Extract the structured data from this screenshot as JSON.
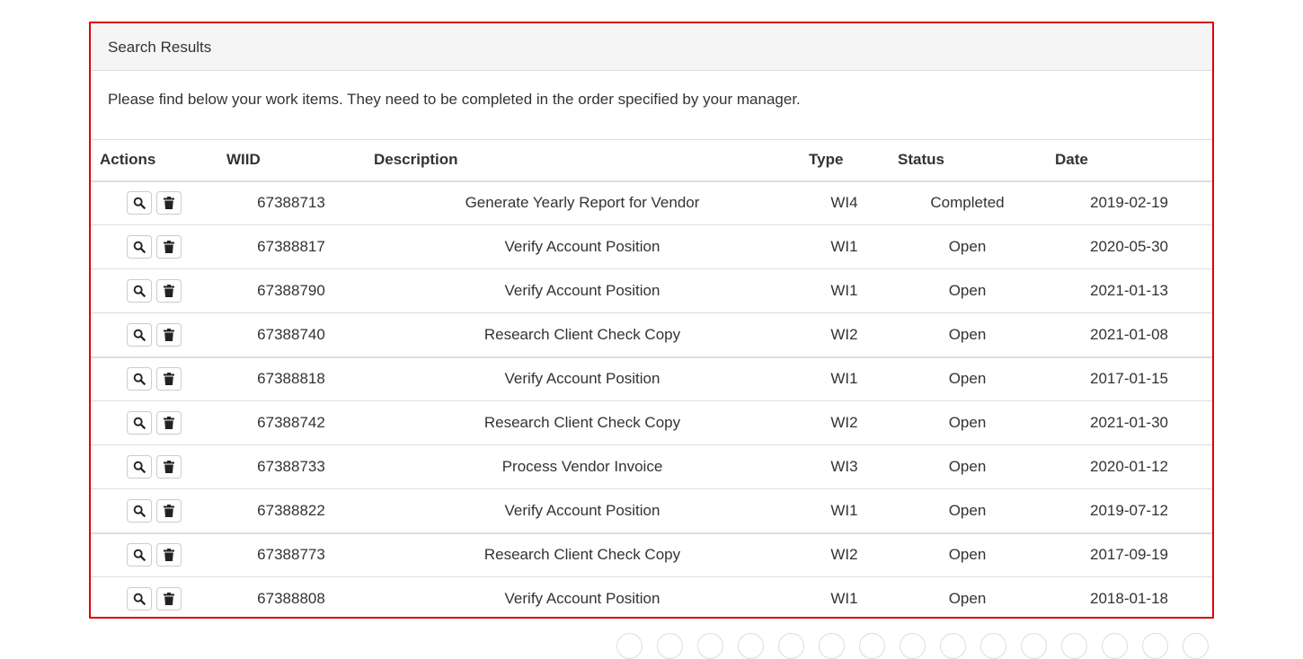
{
  "panel": {
    "heading": "Search Results",
    "intro": "Please find below your work items. They need to be completed in the order specified by your manager.",
    "border_color": "#e00000"
  },
  "table": {
    "headers": {
      "actions": "Actions",
      "wiid": "WIID",
      "description": "Description",
      "type": "Type",
      "status": "Status",
      "date": "Date"
    },
    "rows": [
      {
        "wiid": "67388713",
        "description": "Generate Yearly Report for Vendor",
        "type": "WI4",
        "status": "Completed",
        "date": "2019-02-19"
      },
      {
        "wiid": "67388817",
        "description": "Verify Account Position",
        "type": "WI1",
        "status": "Open",
        "date": "2020-05-30"
      },
      {
        "wiid": "67388790",
        "description": "Verify Account Position",
        "type": "WI1",
        "status": "Open",
        "date": "2021-01-13"
      },
      {
        "wiid": "67388740",
        "description": "Research Client Check Copy",
        "type": "WI2",
        "status": "Open",
        "date": "2021-01-08"
      },
      {
        "wiid": "67388818",
        "description": "Verify Account Position",
        "type": "WI1",
        "status": "Open",
        "date": "2017-01-15"
      },
      {
        "wiid": "67388742",
        "description": "Research Client Check Copy",
        "type": "WI2",
        "status": "Open",
        "date": "2021-01-30"
      },
      {
        "wiid": "67388733",
        "description": "Process Vendor Invoice",
        "type": "WI3",
        "status": "Open",
        "date": "2020-01-12"
      },
      {
        "wiid": "67388822",
        "description": "Verify Account Position",
        "type": "WI1",
        "status": "Open",
        "date": "2019-07-12"
      },
      {
        "wiid": "67388773",
        "description": "Research Client Check Copy",
        "type": "WI2",
        "status": "Open",
        "date": "2017-09-19"
      },
      {
        "wiid": "67388808",
        "description": "Verify Account Position",
        "type": "WI1",
        "status": "Open",
        "date": "2018-01-18"
      }
    ],
    "row_actions": [
      "search-icon",
      "trash-icon"
    ]
  },
  "pagination": {
    "visible_page_buttons": 15
  }
}
